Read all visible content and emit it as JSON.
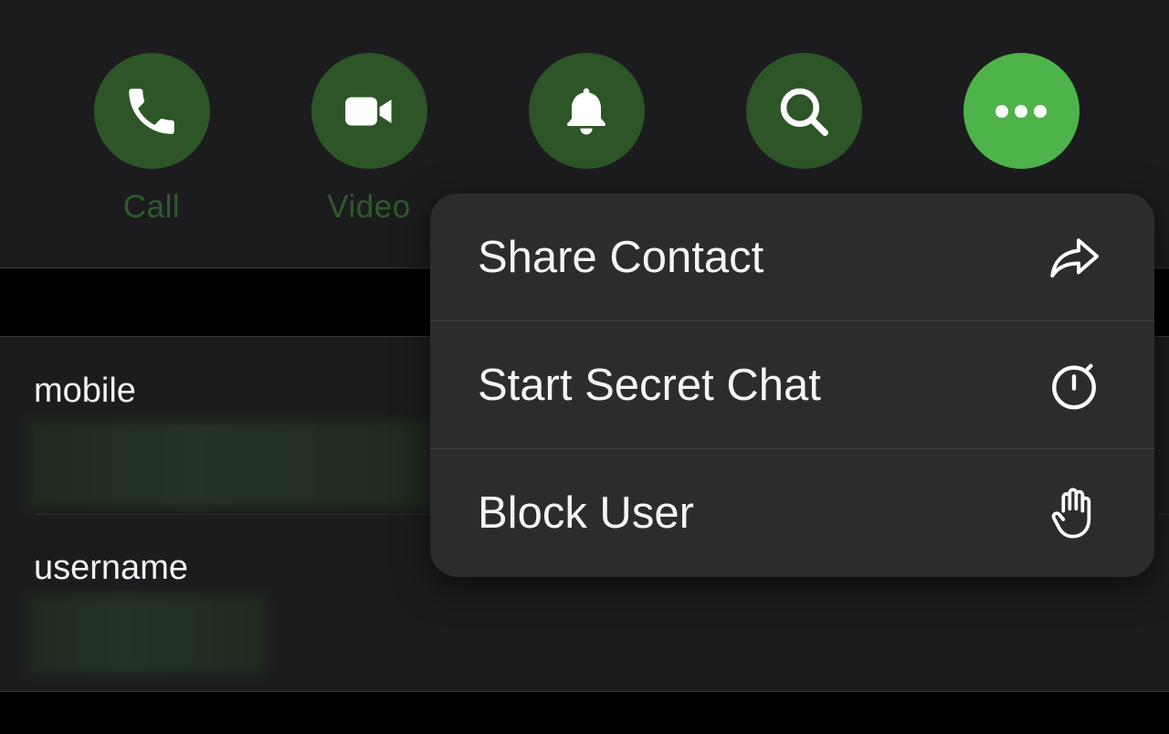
{
  "actions": [
    {
      "id": "call",
      "label": "Call",
      "icon": "phone-icon"
    },
    {
      "id": "video",
      "label": "Video",
      "icon": "video-camera-icon"
    },
    {
      "id": "mute",
      "label": "",
      "icon": "bell-icon"
    },
    {
      "id": "search",
      "label": "",
      "icon": "search-icon"
    },
    {
      "id": "more",
      "label": "",
      "icon": "ellipsis-icon"
    }
  ],
  "info": {
    "mobile_label": "mobile",
    "username_label": "username"
  },
  "menu": {
    "items": [
      {
        "label": "Share Contact",
        "icon": "share-arrow-icon"
      },
      {
        "label": "Start Secret Chat",
        "icon": "timer-icon"
      },
      {
        "label": "Block User",
        "icon": "hand-icon"
      }
    ]
  },
  "colors": {
    "accent_active": "#4eb34a",
    "accent_dim": "#2d5527",
    "panel": "#1c1c1e",
    "menu": "#2c2c2e"
  }
}
